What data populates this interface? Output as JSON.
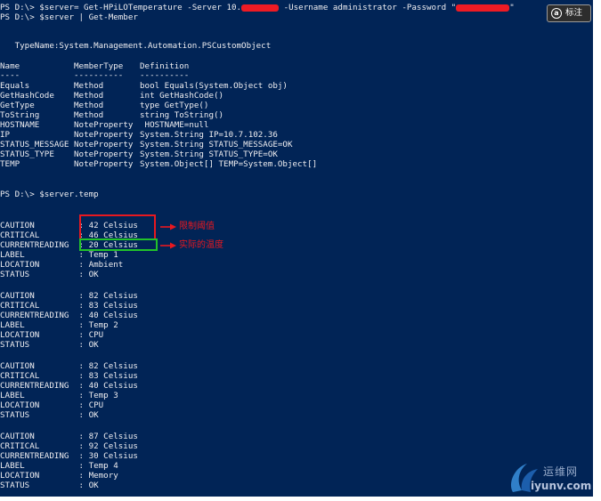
{
  "console": {
    "background": "#012456",
    "foreground": "#eeedf0",
    "command1": {
      "prefix": "PS D:\\> $server= Get-HPiLOTemperature -Server 10.",
      "middle": " -Username administrator -Password \"",
      "suffix": "\""
    },
    "command2": "PS D:\\> $server | Get-Member",
    "type_name": "   TypeName:System.Management.Automation.PSCustomObject",
    "members_header": {
      "name": "Name",
      "member_type": "MemberType",
      "definition": "Definition"
    },
    "members_underline": {
      "name": "----",
      "member_type": "----------",
      "definition": "----------"
    },
    "members": [
      {
        "name": "Equals",
        "member_type": "Method",
        "definition": "bool Equals(System.Object obj)"
      },
      {
        "name": "GetHashCode",
        "member_type": "Method",
        "definition": "int GetHashCode()"
      },
      {
        "name": "GetType",
        "member_type": "Method",
        "definition": "type GetType()"
      },
      {
        "name": "ToString",
        "member_type": "Method",
        "definition": "string ToString()"
      },
      {
        "name": "HOSTNAME",
        "member_type": "NoteProperty",
        "definition": " HOSTNAME=null"
      },
      {
        "name": "IP",
        "member_type": "NoteProperty",
        "definition": "System.String IP=10.7.102.36"
      },
      {
        "name": "STATUS_MESSAGE",
        "member_type": "NoteProperty",
        "definition": "System.String STATUS_MESSAGE=OK"
      },
      {
        "name": "STATUS_TYPE",
        "member_type": "NoteProperty",
        "definition": "System.String STATUS_TYPE=OK"
      },
      {
        "name": "TEMP",
        "member_type": "NoteProperty",
        "definition": "System.Object[] TEMP=System.Object[]"
      }
    ],
    "command3": "PS D:\\> $server.temp",
    "sensors": [
      {
        "caution": "42 Celsius",
        "critical": "46 Celsius",
        "current": "20 Celsius",
        "label": "Temp 1",
        "location": "Ambient",
        "status": "OK"
      },
      {
        "caution": "82 Celsius",
        "critical": "83 Celsius",
        "current": "40 Celsius",
        "label": "Temp 2",
        "location": "CPU",
        "status": "OK"
      },
      {
        "caution": "82 Celsius",
        "critical": "83 Celsius",
        "current": "40 Celsius",
        "label": "Temp 3",
        "location": "CPU",
        "status": "OK"
      },
      {
        "caution": "87 Celsius",
        "critical": "92 Celsius",
        "current": "30 Celsius",
        "label": "Temp 4",
        "location": "Memory",
        "status": "OK"
      }
    ],
    "field_labels": {
      "caution": "CAUTION         : ",
      "critical": "CRITICAL        : ",
      "current": "CURRENTREADING  : ",
      "label": "LABEL           : ",
      "location": "LOCATION        : ",
      "status": "STATUS          : "
    }
  },
  "annotations": {
    "threshold_label": "限制阈值",
    "actual_label": "实际的温度",
    "red": "#e8181f",
    "green": "#22c22a"
  },
  "badge": {
    "label": "标注"
  },
  "watermark": {
    "name": "运维网",
    "domain": "iyunv.com"
  }
}
